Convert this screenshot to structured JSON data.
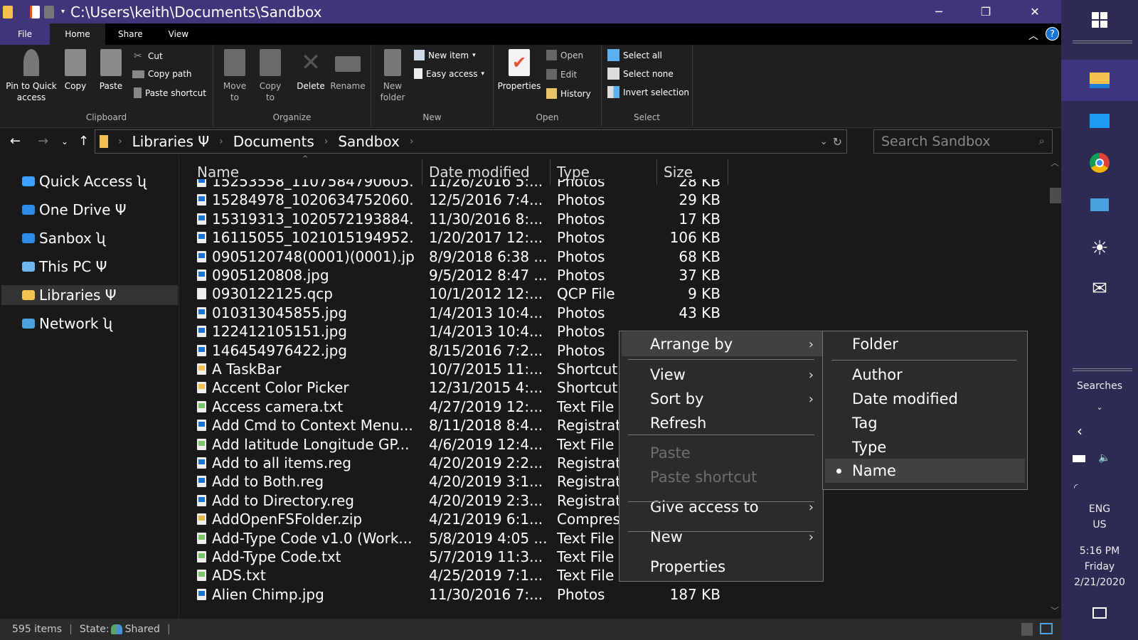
{
  "window": {
    "title": "C:\\Users\\keith\\Documents\\Sandbox",
    "minimize": "─",
    "maximize": "❐",
    "close": "✕",
    "help": "?"
  },
  "ribbon_tabs": [
    "File",
    "Home",
    "Share",
    "View"
  ],
  "ribbon": {
    "clipboard": {
      "label": "Clipboard",
      "pin": "Pin to Quick access",
      "copy": "Copy",
      "paste": "Paste",
      "cut": "Cut",
      "copy_path": "Copy path",
      "paste_shortcut": "Paste shortcut"
    },
    "organize": {
      "label": "Organize",
      "move_to": "Move to",
      "copy_to": "Copy to",
      "delete": "Delete",
      "rename": "Rename"
    },
    "new": {
      "label": "New",
      "new_folder": "New folder",
      "new_item": "New item",
      "easy_access": "Easy access"
    },
    "open": {
      "label": "Open",
      "properties": "Properties",
      "open": "Open",
      "edit": "Edit",
      "history": "History"
    },
    "select": {
      "label": "Select",
      "select_all": "Select all",
      "select_none": "Select none",
      "invert": "Invert selection"
    }
  },
  "address": {
    "crumbs": [
      "Libraries Ψ",
      "Documents",
      "Sandbox"
    ],
    "search_placeholder": "Search Sandbox"
  },
  "nav_pane": [
    {
      "label": "Quick Access ʯ",
      "icon": "star-icon",
      "color": "#3aa0ff"
    },
    {
      "label": "One Drive Ψ",
      "icon": "cloud-icon",
      "color": "#2b8be6"
    },
    {
      "label": "Sanbox ʯ",
      "icon": "cloud-icon",
      "color": "#2b8be6"
    },
    {
      "label": "This PC Ψ",
      "icon": "computer-icon",
      "color": "#6fb6ee"
    },
    {
      "label": "Libraries Ψ",
      "icon": "libraries-icon",
      "color": "#f2c14e",
      "selected": true
    },
    {
      "label": "Network ʯ",
      "icon": "network-icon",
      "color": "#4aa3df"
    }
  ],
  "columns": {
    "name": "Name",
    "date": "Date modified",
    "type": "Type",
    "size": "Size"
  },
  "files": [
    {
      "name": "15253558_1107584790605...",
      "date": "11/26/2016 5:...",
      "type": "Photos",
      "size": "28 KB",
      "icon": "image"
    },
    {
      "name": "15284978_1020634752060...",
      "date": "12/5/2016 7:4...",
      "type": "Photos",
      "size": "29 KB",
      "icon": "image"
    },
    {
      "name": "15319313_1020572193884...",
      "date": "11/30/2016 8:...",
      "type": "Photos",
      "size": "17 KB",
      "icon": "image"
    },
    {
      "name": "16115055_1021015194952...",
      "date": "1/20/2017 12:...",
      "type": "Photos",
      "size": "106 KB",
      "icon": "image"
    },
    {
      "name": "0905120748(0001)(0001).jpg",
      "date": "8/9/2018 6:38 ...",
      "type": "Photos",
      "size": "68 KB",
      "icon": "image"
    },
    {
      "name": "0905120808.jpg",
      "date": "9/5/2012 8:47 ...",
      "type": "Photos",
      "size": "37 KB",
      "icon": "image"
    },
    {
      "name": "0930122125.qcp",
      "date": "10/1/2012 12:...",
      "type": "QCP File",
      "size": "9 KB",
      "icon": "blank"
    },
    {
      "name": "010313045855.jpg",
      "date": "1/4/2013 10:4...",
      "type": "Photos",
      "size": "43 KB",
      "icon": "image"
    },
    {
      "name": "122412105151.jpg",
      "date": "1/4/2013 10:4...",
      "type": "Photos",
      "size": "",
      "icon": "image"
    },
    {
      "name": "146454976422.jpg",
      "date": "8/15/2016 7:2...",
      "type": "Photos",
      "size": "",
      "icon": "image"
    },
    {
      "name": "A TaskBar",
      "date": "10/7/2015 11:...",
      "type": "Shortcut",
      "size": "",
      "icon": "shortcut"
    },
    {
      "name": "Accent Color Picker",
      "date": "12/31/2015 4:...",
      "type": "Shortcut",
      "size": "",
      "icon": "shortcut"
    },
    {
      "name": "Access camera.txt",
      "date": "4/27/2019 12:...",
      "type": "Text File",
      "size": "",
      "icon": "text"
    },
    {
      "name": "Add Cmd to Context Menu...",
      "date": "8/11/2018 8:4...",
      "type": "Registrati",
      "size": "",
      "icon": "reg"
    },
    {
      "name": "Add latitude Longitude GP...",
      "date": "4/6/2019 12:4...",
      "type": "Text File",
      "size": "",
      "icon": "text"
    },
    {
      "name": "Add to all items.reg",
      "date": "4/20/2019 2:2...",
      "type": "Registrati",
      "size": "",
      "icon": "reg"
    },
    {
      "name": "Add to Both.reg",
      "date": "4/20/2019 3:1...",
      "type": "Registrati",
      "size": "",
      "icon": "reg"
    },
    {
      "name": "Add to Directory.reg",
      "date": "4/20/2019 2:3...",
      "type": "Registrati",
      "size": "",
      "icon": "reg"
    },
    {
      "name": "AddOpenFSFolder.zip",
      "date": "4/21/2019 6:1...",
      "type": "Compres",
      "size": "",
      "icon": "zip"
    },
    {
      "name": "Add-Type Code v1.0 (Work...",
      "date": "5/8/2019 4:05 ...",
      "type": "Text File",
      "size": "",
      "icon": "text"
    },
    {
      "name": "Add-Type Code.txt",
      "date": "5/7/2019 11:3...",
      "type": "Text File",
      "size": "",
      "icon": "text"
    },
    {
      "name": "ADS.txt",
      "date": "4/25/2019 7:1...",
      "type": "Text File",
      "size": "1 KB",
      "icon": "text"
    },
    {
      "name": "Alien Chimp.jpg",
      "date": "11/30/2016 7:...",
      "type": "Photos",
      "size": "187 KB",
      "icon": "image"
    }
  ],
  "status": {
    "count": "595 items",
    "state_label": "State:",
    "state_value": "Shared"
  },
  "context_menu": {
    "items": [
      {
        "label": "Arrange by",
        "submenu": true,
        "highlighted": true
      },
      {
        "label": "View",
        "submenu": true
      },
      {
        "label": "Sort by",
        "submenu": true
      },
      {
        "label": "Refresh"
      },
      {
        "label": "Paste",
        "disabled": true
      },
      {
        "label": "Paste shortcut",
        "disabled": true
      },
      {
        "label": "Give access to",
        "submenu": true
      },
      {
        "label": "New",
        "submenu": true
      },
      {
        "label": "Properties"
      }
    ]
  },
  "submenu": {
    "items": [
      {
        "label": "Folder"
      },
      {
        "label": "Author"
      },
      {
        "label": "Date modified"
      },
      {
        "label": "Tag"
      },
      {
        "label": "Type"
      },
      {
        "label": "Name",
        "selected": true
      }
    ]
  },
  "taskbar": {
    "apps": [
      "file-explorer-icon",
      "desktop-icon",
      "chrome-icon",
      "magnifier-icon",
      "brightness-icon",
      "mail-icon"
    ],
    "searches": "Searches",
    "lang": "ENG",
    "region": "US",
    "time": "5:16 PM",
    "day": "Friday",
    "date": "2/21/2020"
  },
  "colors": {
    "title_bar": "#40347a",
    "taskbar": "#2d2a53",
    "background": "#191919",
    "accent": "#1874d2"
  }
}
